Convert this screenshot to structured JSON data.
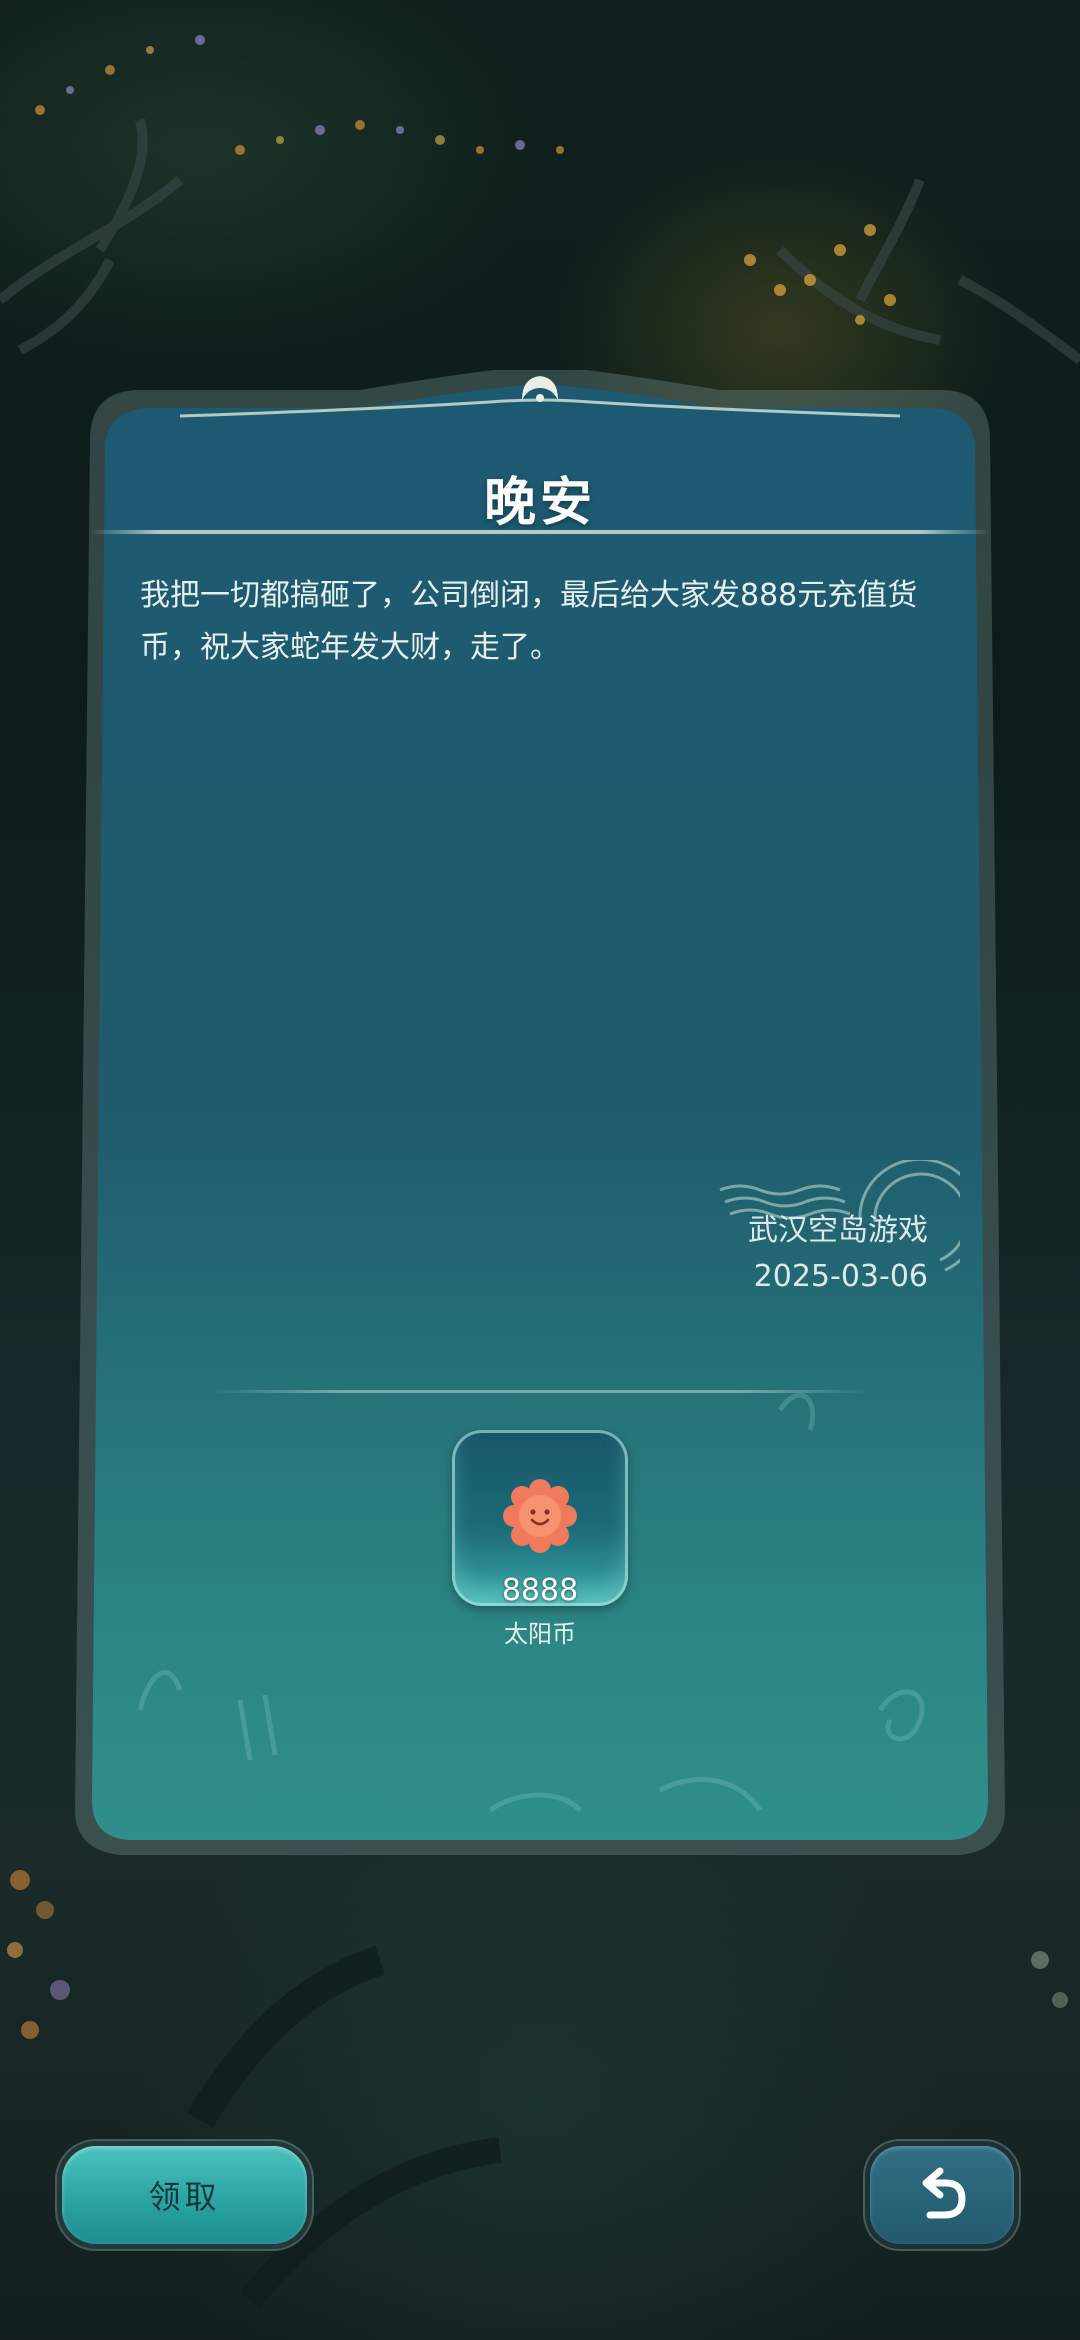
{
  "dialog": {
    "title": "晚安",
    "message": "我把一切都搞砸了，公司倒闭，最后给大家发888元充值货币，祝大家蛇年发大财，走了。",
    "sender": "武汉空岛游戏",
    "date": "2025-03-06"
  },
  "reward": {
    "amount": "8888",
    "name": "太阳币",
    "icon": "sun-coin-icon"
  },
  "buttons": {
    "claim_label": "领取",
    "back_icon": "undo-arrow-icon"
  },
  "colors": {
    "panel_top": "#1d5a72",
    "panel_bottom": "#2d8b8a",
    "accent": "#3bb8b3",
    "coin": "#f07a5c"
  }
}
